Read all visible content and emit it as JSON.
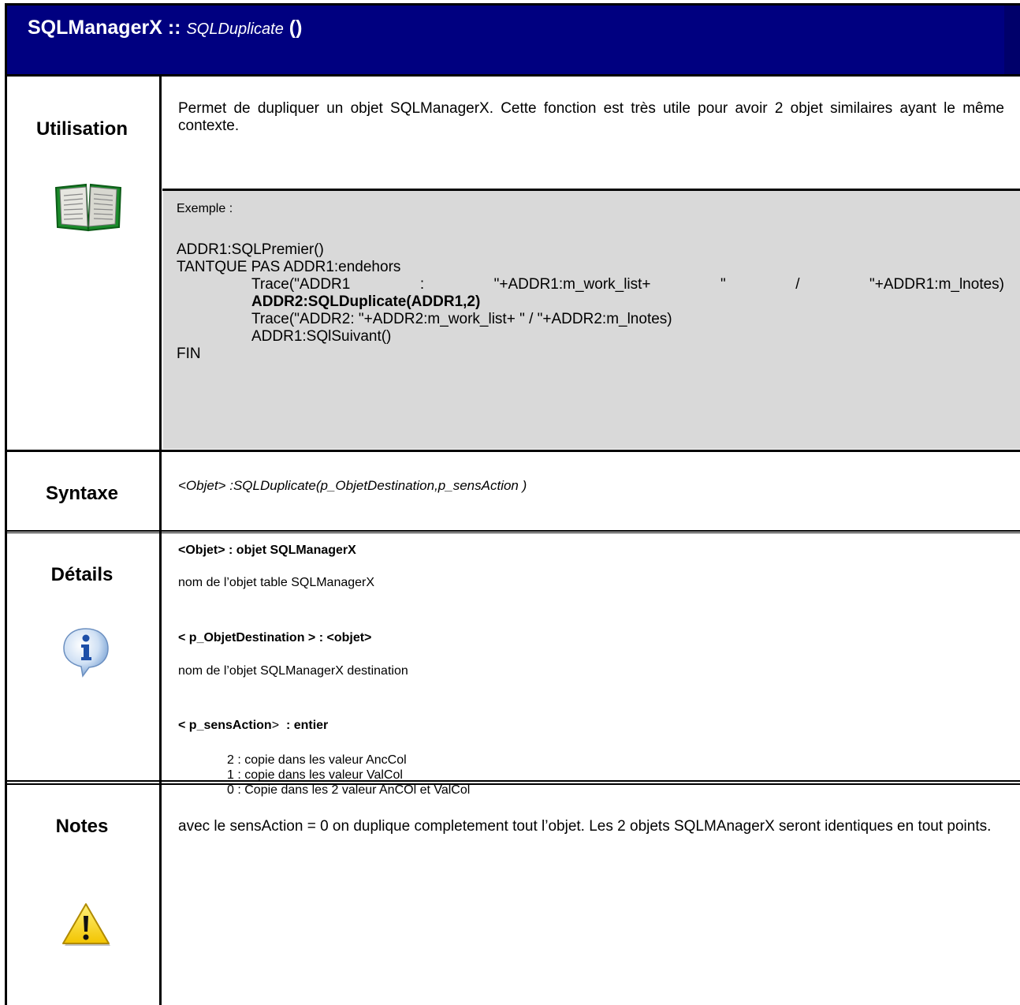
{
  "header": {
    "class_name": "SQLManagerX ::",
    "method_name": "SQLDuplicate",
    "parens": "()"
  },
  "utilisation": {
    "label": "Utilisation",
    "icon": "book-icon",
    "description": "Permet de dupliquer un objet SQLManagerX. Cette fonction est très utile pour avoir 2 objet similaires ayant le même contexte.",
    "example_label": "Exemple :",
    "code": {
      "line1": "ADDR1:SQLPremier()",
      "line2": "TANTQUE PAS ADDR1:endehors",
      "line3": "Trace(\"ADDR1 : \"+ADDR1:m_work_list+ \" / \"+ADDR1:m_lnotes)",
      "line4": "ADDR2:SQLDuplicate(ADDR1,2)",
      "line5": "Trace(\"ADDR2: \"+ADDR2:m_work_list+ \" / \"+ADDR2:m_lnotes)",
      "line6": "ADDR1:SQlSuivant()",
      "line7": "FIN"
    }
  },
  "syntaxe": {
    "label": "Syntaxe",
    "signature_part1": "<Objet>",
    "signature_part2": " :SQLDuplicate(p_ObjetDestination,p_sensAction )"
  },
  "details": {
    "label": "Détails",
    "icon": "info-icon",
    "param1_head": "<Objet> : objet SQLManagerX",
    "param1_text": "nom de l’objet table SQLManagerX",
    "param2_head": "< p_ObjetDestination > : <objet>",
    "param2_text": "nom de l’objet SQLManagerX destination",
    "param3_head_a": "< p_sensAction",
    "param3_head_b": ">",
    "param3_head_c": "  : entier",
    "options": [
      "2 : copie dans les valeur AncCol",
      "1 : copie dans les valeur ValCol",
      "0 : Copie dans les 2 valeur AnCOl et ValCol"
    ]
  },
  "notes": {
    "label": "Notes",
    "icon": "warning-icon",
    "text": "avec le sensAction = 0 on duplique completement tout l’objet. Les 2 objets SQLMAnagerX seront identiques en tout points."
  },
  "colors": {
    "header_bg": "#000080",
    "example_bg": "#d9d9d9"
  }
}
